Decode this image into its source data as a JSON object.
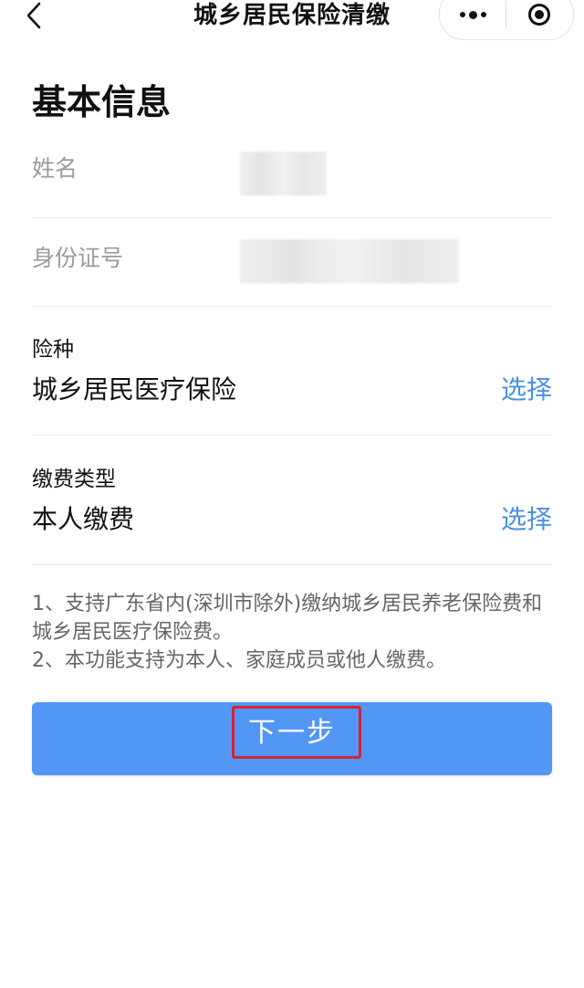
{
  "nav": {
    "title": "城乡居民保险清缴"
  },
  "section": {
    "title": "基本信息"
  },
  "info": {
    "name_label": "姓名",
    "id_label": "身份证号"
  },
  "insurance": {
    "label": "险种",
    "value": "城乡居民医疗保险",
    "select_label": "选择"
  },
  "payment": {
    "label": "缴费类型",
    "value": "本人缴费",
    "select_label": "选择"
  },
  "notes": [
    "1、支持广东省内(深圳市除外)缴纳城乡居民养老保险费和城乡居民医疗保险费。",
    "2、本功能支持为本人、家庭成员或他人缴费。"
  ],
  "actions": {
    "next_label": "下一步"
  },
  "colors": {
    "accent": "#5297f5",
    "link": "#4a90e2",
    "highlight": "#d9232b"
  }
}
